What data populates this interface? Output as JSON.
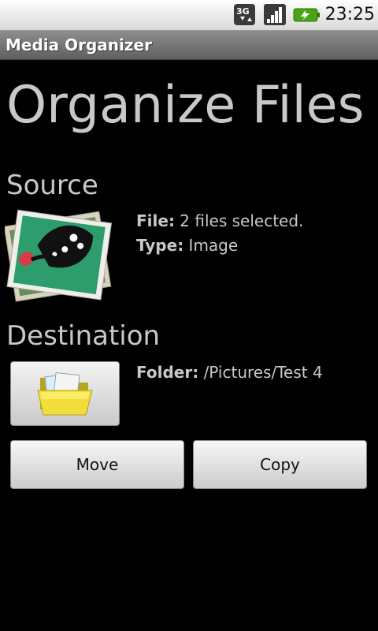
{
  "status_bar": {
    "network_icon": "3g-data-icon",
    "signal_icon": "signal-strength-icon",
    "battery_icon": "battery-charging-icon",
    "time": "23:25",
    "accent_color": "#4aa414"
  },
  "app_bar": {
    "title": "Media Organizer"
  },
  "main": {
    "heading": "Organize Files",
    "source": {
      "title": "Source",
      "thumbnail_icon": "butterfly-photo-stack-icon",
      "file_label": "File:",
      "file_value": "2 files selected.",
      "type_label": "Type:",
      "type_value": "Image"
    },
    "destination": {
      "title": "Destination",
      "folder_button_icon": "folder-icon",
      "folder_label": "Folder:",
      "folder_value": "/Pictures/Test 4"
    },
    "actions": {
      "move_label": "Move",
      "copy_label": "Copy"
    }
  }
}
